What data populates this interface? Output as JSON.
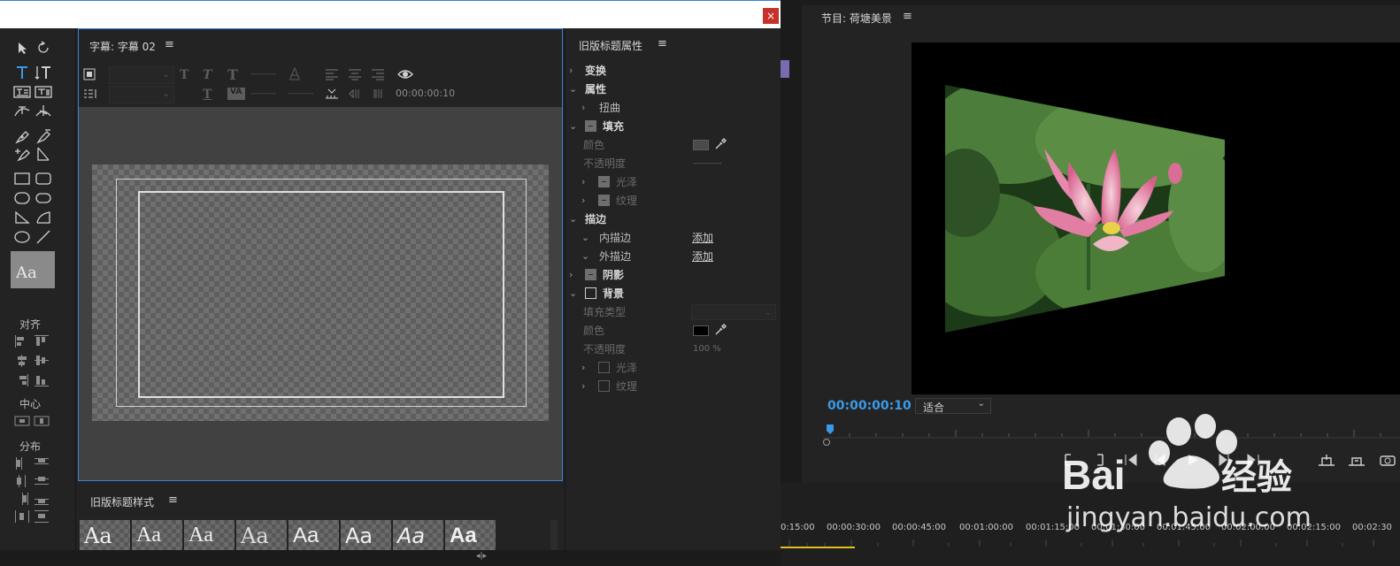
{
  "window": {
    "close_glyph": "×"
  },
  "tools_panel": {
    "swatch_text": "Aa",
    "align_label": "对齐",
    "center_label": "中心",
    "distribute_label": "分布"
  },
  "caption_panel": {
    "tab_title": "字幕: 字幕 02",
    "menu_glyph": "≡",
    "timecode": "00:00:00:10",
    "dashes_a": "---------",
    "dashes_b": "---------",
    "dashes_c": "---------"
  },
  "styles_panel": {
    "tab_title": "旧版标题样式",
    "menu_glyph": "≡",
    "samples": [
      "Aa",
      "Aa",
      "Aa",
      "Aa",
      "Aa",
      "Aa",
      "Aa",
      "Aa"
    ]
  },
  "properties_panel": {
    "tab_title": "旧版标题属性",
    "menu_glyph": "≡",
    "transform": "变换",
    "properties": "属性",
    "distort": "扭曲",
    "fill": "填充",
    "fill_color": "颜色",
    "fill_opacity": "不透明度",
    "fill_opacity_value": "----------",
    "fill_gloss": "光泽",
    "fill_texture": "纹理",
    "stroke": "描边",
    "inner_stroke": "内描边",
    "outer_stroke": "外描边",
    "add": "添加",
    "shadow": "阴影",
    "background": "背景",
    "bg_fill_type": "填充类型",
    "bg_color": "颜色",
    "bg_opacity": "不透明度",
    "bg_opacity_value": "100 %",
    "bg_gloss": "光泽",
    "bg_texture": "纹理",
    "fill_swatch_color": "#4a4a4a",
    "bg_swatch_color": "#000000"
  },
  "program_monitor": {
    "tab_title": "节目: 荷塘美景",
    "menu_glyph": "≡",
    "timecode": "00:00:00:10",
    "fit_option": "适合",
    "timecode_color": "#3a9ae8"
  },
  "timeline": {
    "labels": [
      "0:15:00",
      "00:00:30:00",
      "00:00:45:00",
      "00:01:00:00",
      "00:01:15:00",
      "00:01:30:00",
      "00:01:45:00",
      "00:02:00:00",
      "00:02:15:00",
      "00:02:30"
    ]
  },
  "watermark": {
    "text": "jingyan.baidu.com"
  },
  "colors": {
    "accent": "#3a82d6",
    "close": "#c8312b"
  }
}
